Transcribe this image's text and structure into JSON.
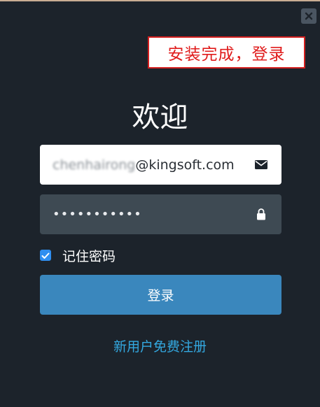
{
  "annotation": {
    "text": "安装完成，登录"
  },
  "login": {
    "title": "欢迎",
    "email": {
      "blurred_part": "chenhairong",
      "domain_part": "@kingsoft.com"
    },
    "password": {
      "masked_value": "•••••••••••"
    },
    "remember": {
      "label": "记住密码",
      "checked": true
    },
    "submit_label": "登录",
    "register_link": "新用户免费注册"
  },
  "icons": {
    "close": "close-icon",
    "email": "envelope-icon",
    "password": "lock-icon",
    "checkbox": "checkmark-icon"
  },
  "colors": {
    "background": "#1c232b",
    "accent_button": "#3a87bd",
    "link": "#33a8e0",
    "annotation_border": "#d41f1f",
    "annotation_text": "#e01b1b",
    "checkbox": "#2f8ef0"
  }
}
